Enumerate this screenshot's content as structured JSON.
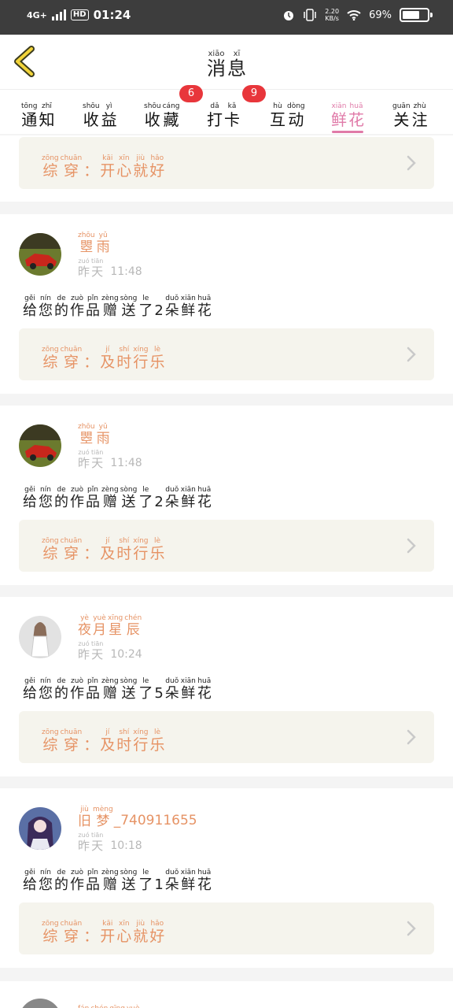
{
  "status_bar": {
    "network": "4G+",
    "hd": "HD",
    "time": "01:24",
    "speed_value": "2.20",
    "speed_unit": "KB/s",
    "battery": "69%",
    "battery_level": 0.69,
    "icons": [
      "alarm-icon",
      "vibrate-icon",
      "wifi-icon",
      "battery-icon"
    ]
  },
  "header": {
    "back_icon": "chevron-left-icon",
    "title": [
      {
        "pin": "xiāo",
        "han": "消"
      },
      {
        "pin": "xī",
        "han": "息"
      }
    ]
  },
  "tabs": [
    {
      "chars": [
        {
          "pin": "tōng",
          "han": "通"
        },
        {
          "pin": "zhī",
          "han": "知"
        }
      ],
      "badge": ""
    },
    {
      "chars": [
        {
          "pin": "shōu",
          "han": "收"
        },
        {
          "pin": "yì",
          "han": "益"
        }
      ],
      "badge": ""
    },
    {
      "chars": [
        {
          "pin": "shōu",
          "han": "收"
        },
        {
          "pin": "cáng",
          "han": "藏"
        }
      ],
      "badge": "6"
    },
    {
      "chars": [
        {
          "pin": "dǎ",
          "han": "打"
        },
        {
          "pin": "kǎ",
          "han": "卡"
        }
      ],
      "badge": "9"
    },
    {
      "chars": [
        {
          "pin": "hù",
          "han": "互"
        },
        {
          "pin": "dòng",
          "han": "动"
        }
      ],
      "badge": ""
    },
    {
      "chars": [
        {
          "pin": "xiān",
          "han": "鲜"
        },
        {
          "pin": "huā",
          "han": "花"
        }
      ],
      "badge": "",
      "active": true
    },
    {
      "chars": [
        {
          "pin": "guān",
          "han": "关"
        },
        {
          "pin": "zhù",
          "han": "注"
        }
      ],
      "badge": ""
    }
  ],
  "top_partial_work": [
    {
      "pin": "zōng",
      "han": "综"
    },
    {
      "pin": "chuān",
      "han": "穿"
    },
    {
      "pin": "",
      "han": "："
    },
    {
      "pin": "kāi",
      "han": "开"
    },
    {
      "pin": "xīn",
      "han": "心"
    },
    {
      "pin": "jiù",
      "han": "就"
    },
    {
      "pin": "hǎo",
      "han": "好"
    }
  ],
  "messages": [
    {
      "user": [
        {
          "pin": "zhōu",
          "han": "瞾"
        },
        {
          "pin": "yǔ",
          "han": "雨"
        }
      ],
      "user_suffix": "",
      "day": [
        {
          "pin": "zuó",
          "han": "昨"
        },
        {
          "pin": "tiān",
          "han": "天"
        }
      ],
      "clock": "11:48",
      "text": [
        {
          "pin": "gěi",
          "han": "给"
        },
        {
          "pin": "nín",
          "han": "您"
        },
        {
          "pin": "de",
          "han": "的"
        },
        {
          "pin": "zuò",
          "han": "作"
        },
        {
          "pin": "pǐn",
          "han": "品"
        },
        {
          "pin": "zèng",
          "han": "赠"
        },
        {
          "pin": "sòng",
          "han": "送"
        },
        {
          "pin": "le",
          "han": "了"
        },
        {
          "pin": "",
          "han": "2"
        },
        {
          "pin": "duǒ",
          "han": "朵"
        },
        {
          "pin": "xiān",
          "han": "鲜"
        },
        {
          "pin": "huā",
          "han": "花"
        }
      ],
      "work": [
        {
          "pin": "zōng",
          "han": "综"
        },
        {
          "pin": "chuān",
          "han": "穿"
        },
        {
          "pin": "",
          "han": "："
        },
        {
          "pin": "jí",
          "han": "及"
        },
        {
          "pin": "shí",
          "han": "时"
        },
        {
          "pin": "xíng",
          "han": "行"
        },
        {
          "pin": "lè",
          "han": "乐"
        }
      ],
      "avatar": "avatar-red-car"
    },
    {
      "user": [
        {
          "pin": "zhōu",
          "han": "瞾"
        },
        {
          "pin": "yǔ",
          "han": "雨"
        }
      ],
      "user_suffix": "",
      "day": [
        {
          "pin": "zuó",
          "han": "昨"
        },
        {
          "pin": "tiān",
          "han": "天"
        }
      ],
      "clock": "11:48",
      "text": [
        {
          "pin": "gěi",
          "han": "给"
        },
        {
          "pin": "nín",
          "han": "您"
        },
        {
          "pin": "de",
          "han": "的"
        },
        {
          "pin": "zuò",
          "han": "作"
        },
        {
          "pin": "pǐn",
          "han": "品"
        },
        {
          "pin": "zèng",
          "han": "赠"
        },
        {
          "pin": "sòng",
          "han": "送"
        },
        {
          "pin": "le",
          "han": "了"
        },
        {
          "pin": "",
          "han": "2"
        },
        {
          "pin": "duǒ",
          "han": "朵"
        },
        {
          "pin": "xiān",
          "han": "鲜"
        },
        {
          "pin": "huā",
          "han": "花"
        }
      ],
      "work": [
        {
          "pin": "zōng",
          "han": "综"
        },
        {
          "pin": "chuān",
          "han": "穿"
        },
        {
          "pin": "",
          "han": "："
        },
        {
          "pin": "jí",
          "han": "及"
        },
        {
          "pin": "shí",
          "han": "时"
        },
        {
          "pin": "xíng",
          "han": "行"
        },
        {
          "pin": "lè",
          "han": "乐"
        }
      ],
      "avatar": "avatar-red-car"
    },
    {
      "user": [
        {
          "pin": "yè",
          "han": "夜"
        },
        {
          "pin": "yuè",
          "han": "月"
        },
        {
          "pin": "xīng",
          "han": "星"
        },
        {
          "pin": "chén",
          "han": "辰"
        }
      ],
      "user_suffix": "",
      "day": [
        {
          "pin": "zuó",
          "han": "昨"
        },
        {
          "pin": "tiān",
          "han": "天"
        }
      ],
      "clock": "10:24",
      "text": [
        {
          "pin": "gěi",
          "han": "给"
        },
        {
          "pin": "nín",
          "han": "您"
        },
        {
          "pin": "de",
          "han": "的"
        },
        {
          "pin": "zuò",
          "han": "作"
        },
        {
          "pin": "pǐn",
          "han": "品"
        },
        {
          "pin": "zèng",
          "han": "赠"
        },
        {
          "pin": "sòng",
          "han": "送"
        },
        {
          "pin": "le",
          "han": "了"
        },
        {
          "pin": "",
          "han": "5"
        },
        {
          "pin": "duǒ",
          "han": "朵"
        },
        {
          "pin": "xiān",
          "han": "鲜"
        },
        {
          "pin": "huā",
          "han": "花"
        }
      ],
      "work": [
        {
          "pin": "zōng",
          "han": "综"
        },
        {
          "pin": "chuān",
          "han": "穿"
        },
        {
          "pin": "",
          "han": "："
        },
        {
          "pin": "jí",
          "han": "及"
        },
        {
          "pin": "shí",
          "han": "时"
        },
        {
          "pin": "xíng",
          "han": "行"
        },
        {
          "pin": "lè",
          "han": "乐"
        }
      ],
      "avatar": "avatar-girl"
    },
    {
      "user": [
        {
          "pin": "jiù",
          "han": "旧"
        },
        {
          "pin": "mèng",
          "han": "梦"
        }
      ],
      "user_suffix": "_740911655",
      "day": [
        {
          "pin": "zuó",
          "han": "昨"
        },
        {
          "pin": "tiān",
          "han": "天"
        }
      ],
      "clock": "10:18",
      "text": [
        {
          "pin": "gěi",
          "han": "给"
        },
        {
          "pin": "nín",
          "han": "您"
        },
        {
          "pin": "de",
          "han": "的"
        },
        {
          "pin": "zuò",
          "han": "作"
        },
        {
          "pin": "pǐn",
          "han": "品"
        },
        {
          "pin": "zèng",
          "han": "赠"
        },
        {
          "pin": "sòng",
          "han": "送"
        },
        {
          "pin": "le",
          "han": "了"
        },
        {
          "pin": "",
          "han": "1"
        },
        {
          "pin": "duǒ",
          "han": "朵"
        },
        {
          "pin": "xiān",
          "han": "鲜"
        },
        {
          "pin": "huā",
          "han": "花"
        }
      ],
      "work": [
        {
          "pin": "zōng",
          "han": "综"
        },
        {
          "pin": "chuān",
          "han": "穿"
        },
        {
          "pin": "",
          "han": "："
        },
        {
          "pin": "kāi",
          "han": "开"
        },
        {
          "pin": "xīn",
          "han": "心"
        },
        {
          "pin": "jiù",
          "han": "就"
        },
        {
          "pin": "hǎo",
          "han": "好"
        }
      ],
      "avatar": "avatar-anime"
    }
  ],
  "next_user_partial": [
    {
      "pin": "fán",
      "han": ""
    },
    {
      "pin": "chén",
      "han": ""
    },
    {
      "pin": "qīng",
      "han": ""
    },
    {
      "pin": "yuè",
      "han": ""
    }
  ],
  "colors": {
    "accent_pink": "#e07aa8",
    "name_orange": "#e69365",
    "badge_red": "#e8363b",
    "work_bg": "#f5f4ed"
  }
}
